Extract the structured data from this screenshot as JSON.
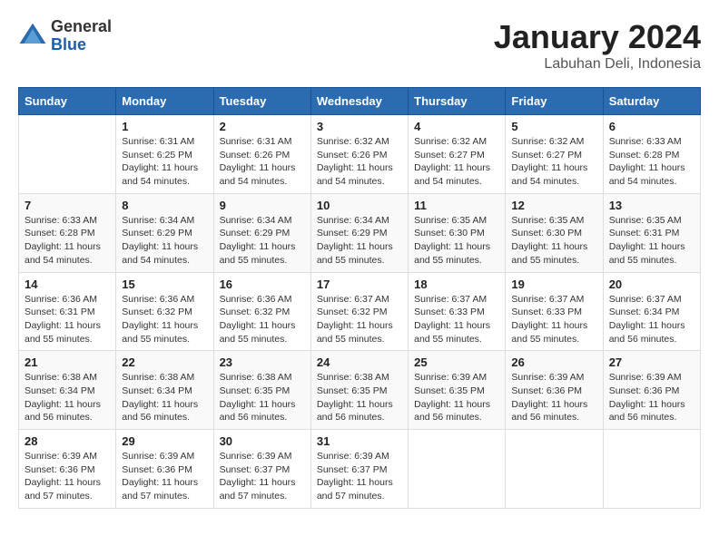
{
  "header": {
    "logo_general": "General",
    "logo_blue": "Blue",
    "month_title": "January 2024",
    "location": "Labuhan Deli, Indonesia"
  },
  "weekdays": [
    "Sunday",
    "Monday",
    "Tuesday",
    "Wednesday",
    "Thursday",
    "Friday",
    "Saturday"
  ],
  "weeks": [
    [
      {
        "day": "",
        "sunrise": "",
        "sunset": "",
        "daylight": ""
      },
      {
        "day": "1",
        "sunrise": "Sunrise: 6:31 AM",
        "sunset": "Sunset: 6:25 PM",
        "daylight": "Daylight: 11 hours and 54 minutes."
      },
      {
        "day": "2",
        "sunrise": "Sunrise: 6:31 AM",
        "sunset": "Sunset: 6:26 PM",
        "daylight": "Daylight: 11 hours and 54 minutes."
      },
      {
        "day": "3",
        "sunrise": "Sunrise: 6:32 AM",
        "sunset": "Sunset: 6:26 PM",
        "daylight": "Daylight: 11 hours and 54 minutes."
      },
      {
        "day": "4",
        "sunrise": "Sunrise: 6:32 AM",
        "sunset": "Sunset: 6:27 PM",
        "daylight": "Daylight: 11 hours and 54 minutes."
      },
      {
        "day": "5",
        "sunrise": "Sunrise: 6:32 AM",
        "sunset": "Sunset: 6:27 PM",
        "daylight": "Daylight: 11 hours and 54 minutes."
      },
      {
        "day": "6",
        "sunrise": "Sunrise: 6:33 AM",
        "sunset": "Sunset: 6:28 PM",
        "daylight": "Daylight: 11 hours and 54 minutes."
      }
    ],
    [
      {
        "day": "7",
        "sunrise": "Sunrise: 6:33 AM",
        "sunset": "Sunset: 6:28 PM",
        "daylight": "Daylight: 11 hours and 54 minutes."
      },
      {
        "day": "8",
        "sunrise": "Sunrise: 6:34 AM",
        "sunset": "Sunset: 6:29 PM",
        "daylight": "Daylight: 11 hours and 54 minutes."
      },
      {
        "day": "9",
        "sunrise": "Sunrise: 6:34 AM",
        "sunset": "Sunset: 6:29 PM",
        "daylight": "Daylight: 11 hours and 55 minutes."
      },
      {
        "day": "10",
        "sunrise": "Sunrise: 6:34 AM",
        "sunset": "Sunset: 6:29 PM",
        "daylight": "Daylight: 11 hours and 55 minutes."
      },
      {
        "day": "11",
        "sunrise": "Sunrise: 6:35 AM",
        "sunset": "Sunset: 6:30 PM",
        "daylight": "Daylight: 11 hours and 55 minutes."
      },
      {
        "day": "12",
        "sunrise": "Sunrise: 6:35 AM",
        "sunset": "Sunset: 6:30 PM",
        "daylight": "Daylight: 11 hours and 55 minutes."
      },
      {
        "day": "13",
        "sunrise": "Sunrise: 6:35 AM",
        "sunset": "Sunset: 6:31 PM",
        "daylight": "Daylight: 11 hours and 55 minutes."
      }
    ],
    [
      {
        "day": "14",
        "sunrise": "Sunrise: 6:36 AM",
        "sunset": "Sunset: 6:31 PM",
        "daylight": "Daylight: 11 hours and 55 minutes."
      },
      {
        "day": "15",
        "sunrise": "Sunrise: 6:36 AM",
        "sunset": "Sunset: 6:32 PM",
        "daylight": "Daylight: 11 hours and 55 minutes."
      },
      {
        "day": "16",
        "sunrise": "Sunrise: 6:36 AM",
        "sunset": "Sunset: 6:32 PM",
        "daylight": "Daylight: 11 hours and 55 minutes."
      },
      {
        "day": "17",
        "sunrise": "Sunrise: 6:37 AM",
        "sunset": "Sunset: 6:32 PM",
        "daylight": "Daylight: 11 hours and 55 minutes."
      },
      {
        "day": "18",
        "sunrise": "Sunrise: 6:37 AM",
        "sunset": "Sunset: 6:33 PM",
        "daylight": "Daylight: 11 hours and 55 minutes."
      },
      {
        "day": "19",
        "sunrise": "Sunrise: 6:37 AM",
        "sunset": "Sunset: 6:33 PM",
        "daylight": "Daylight: 11 hours and 55 minutes."
      },
      {
        "day": "20",
        "sunrise": "Sunrise: 6:37 AM",
        "sunset": "Sunset: 6:34 PM",
        "daylight": "Daylight: 11 hours and 56 minutes."
      }
    ],
    [
      {
        "day": "21",
        "sunrise": "Sunrise: 6:38 AM",
        "sunset": "Sunset: 6:34 PM",
        "daylight": "Daylight: 11 hours and 56 minutes."
      },
      {
        "day": "22",
        "sunrise": "Sunrise: 6:38 AM",
        "sunset": "Sunset: 6:34 PM",
        "daylight": "Daylight: 11 hours and 56 minutes."
      },
      {
        "day": "23",
        "sunrise": "Sunrise: 6:38 AM",
        "sunset": "Sunset: 6:35 PM",
        "daylight": "Daylight: 11 hours and 56 minutes."
      },
      {
        "day": "24",
        "sunrise": "Sunrise: 6:38 AM",
        "sunset": "Sunset: 6:35 PM",
        "daylight": "Daylight: 11 hours and 56 minutes."
      },
      {
        "day": "25",
        "sunrise": "Sunrise: 6:39 AM",
        "sunset": "Sunset: 6:35 PM",
        "daylight": "Daylight: 11 hours and 56 minutes."
      },
      {
        "day": "26",
        "sunrise": "Sunrise: 6:39 AM",
        "sunset": "Sunset: 6:36 PM",
        "daylight": "Daylight: 11 hours and 56 minutes."
      },
      {
        "day": "27",
        "sunrise": "Sunrise: 6:39 AM",
        "sunset": "Sunset: 6:36 PM",
        "daylight": "Daylight: 11 hours and 56 minutes."
      }
    ],
    [
      {
        "day": "28",
        "sunrise": "Sunrise: 6:39 AM",
        "sunset": "Sunset: 6:36 PM",
        "daylight": "Daylight: 11 hours and 57 minutes."
      },
      {
        "day": "29",
        "sunrise": "Sunrise: 6:39 AM",
        "sunset": "Sunset: 6:36 PM",
        "daylight": "Daylight: 11 hours and 57 minutes."
      },
      {
        "day": "30",
        "sunrise": "Sunrise: 6:39 AM",
        "sunset": "Sunset: 6:37 PM",
        "daylight": "Daylight: 11 hours and 57 minutes."
      },
      {
        "day": "31",
        "sunrise": "Sunrise: 6:39 AM",
        "sunset": "Sunset: 6:37 PM",
        "daylight": "Daylight: 11 hours and 57 minutes."
      },
      {
        "day": "",
        "sunrise": "",
        "sunset": "",
        "daylight": ""
      },
      {
        "day": "",
        "sunrise": "",
        "sunset": "",
        "daylight": ""
      },
      {
        "day": "",
        "sunrise": "",
        "sunset": "",
        "daylight": ""
      }
    ]
  ]
}
